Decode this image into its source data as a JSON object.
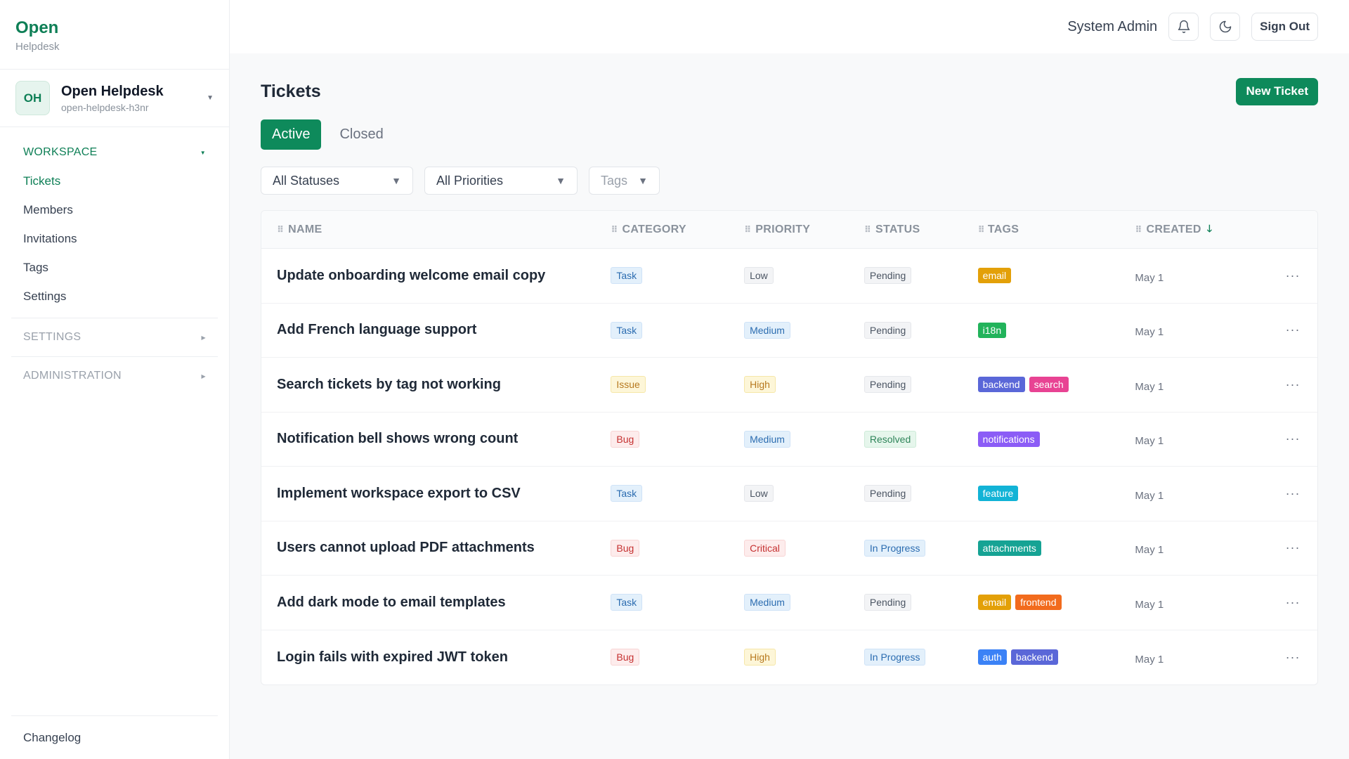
{
  "brand": {
    "title": "Open",
    "subtitle": "Helpdesk"
  },
  "workspace_switcher": {
    "initials": "OH",
    "name": "Open Helpdesk",
    "slug": "open-helpdesk-h3nr"
  },
  "sidebar": {
    "workspace_label": "WORKSPACE",
    "items": [
      {
        "label": "Tickets",
        "active": true
      },
      {
        "label": "Members",
        "active": false
      },
      {
        "label": "Invitations",
        "active": false
      },
      {
        "label": "Tags",
        "active": false
      },
      {
        "label": "Settings",
        "active": false
      }
    ],
    "settings_label": "SETTINGS",
    "administration_label": "ADMINISTRATION",
    "footer_label": "Changelog"
  },
  "topbar": {
    "user_name": "System Admin",
    "signout_label": "Sign Out",
    "bell_icon": "bell-icon",
    "theme_icon": "moon-icon"
  },
  "page": {
    "title": "Tickets",
    "new_ticket_label": "New Ticket",
    "tabs": [
      {
        "label": "Active",
        "active": true
      },
      {
        "label": "Closed",
        "active": false
      }
    ],
    "filters": {
      "status": "All Statuses",
      "priority": "All Priorities",
      "tags": "Tags"
    }
  },
  "table": {
    "columns": {
      "name": "NAME",
      "category": "CATEGORY",
      "priority": "PRIORITY",
      "status": "STATUS",
      "tags": "TAGS",
      "created": "CREATED"
    },
    "rows": [
      {
        "name": "Update onboarding welcome email copy",
        "category": "Task",
        "priority": "Low",
        "status": "Pending",
        "tags": [
          "email"
        ],
        "created": "May 1"
      },
      {
        "name": "Add French language support",
        "category": "Task",
        "priority": "Medium",
        "status": "Pending",
        "tags": [
          "i18n"
        ],
        "created": "May 1"
      },
      {
        "name": "Search tickets by tag not working",
        "category": "Issue",
        "priority": "High",
        "status": "Pending",
        "tags": [
          "backend",
          "search"
        ],
        "created": "May 1"
      },
      {
        "name": "Notification bell shows wrong count",
        "category": "Bug",
        "priority": "Medium",
        "status": "Resolved",
        "tags": [
          "notifications"
        ],
        "created": "May 1"
      },
      {
        "name": "Implement workspace export to CSV",
        "category": "Task",
        "priority": "Low",
        "status": "Pending",
        "tags": [
          "feature"
        ],
        "created": "May 1"
      },
      {
        "name": "Users cannot upload PDF attachments",
        "category": "Bug",
        "priority": "Critical",
        "status": "In Progress",
        "tags": [
          "attachments"
        ],
        "created": "May 1"
      },
      {
        "name": "Add dark mode to email templates",
        "category": "Task",
        "priority": "Medium",
        "status": "Pending",
        "tags": [
          "email",
          "frontend"
        ],
        "created": "May 1"
      },
      {
        "name": "Login fails with expired JWT token",
        "category": "Bug",
        "priority": "High",
        "status": "In Progress",
        "tags": [
          "auth",
          "backend"
        ],
        "created": "May 1"
      }
    ]
  },
  "colors": {
    "accent": "#0e8a5b",
    "category": {
      "Task": {
        "bg": "#e3f0fb",
        "fg": "#2b6cb0",
        "border": "#cfe3f7"
      },
      "Issue": {
        "bg": "#fdf6d8",
        "fg": "#b7791f",
        "border": "#f6e7a8"
      },
      "Bug": {
        "bg": "#fdecec",
        "fg": "#c53030",
        "border": "#f8d4d4"
      }
    },
    "priority": {
      "Low": {
        "bg": "#f3f4f6",
        "fg": "#4b5563",
        "border": "#e5e7eb"
      },
      "Medium": {
        "bg": "#e3f0fb",
        "fg": "#2b6cb0",
        "border": "#cfe3f7"
      },
      "High": {
        "bg": "#fdf6d8",
        "fg": "#b7791f",
        "border": "#f6e7a8"
      },
      "Critical": {
        "bg": "#fdecec",
        "fg": "#c53030",
        "border": "#f8d4d4"
      }
    },
    "status": {
      "Pending": {
        "bg": "#f3f4f6",
        "fg": "#4b5563",
        "border": "#e5e7eb"
      },
      "Resolved": {
        "bg": "#e6f6ec",
        "fg": "#2f855a",
        "border": "#cdebd8"
      },
      "In Progress": {
        "bg": "#e3f0fb",
        "fg": "#2b6cb0",
        "border": "#cfe3f7"
      }
    },
    "tags": {
      "email": "#e3a008",
      "i18n": "#22b35b",
      "backend": "#5a67d8",
      "search": "#e84393",
      "notifications": "#8b5cf6",
      "feature": "#12b3d6",
      "attachments": "#16a394",
      "frontend": "#f26b1d",
      "auth": "#3b82f6"
    }
  }
}
